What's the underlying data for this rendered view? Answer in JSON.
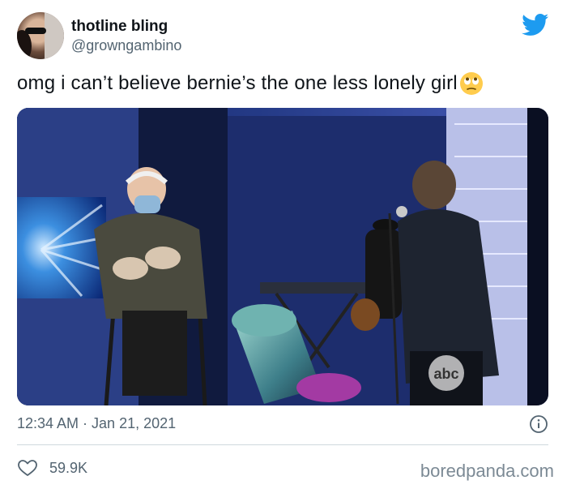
{
  "author": {
    "display_name": "thotline bling",
    "handle": "@growngambino"
  },
  "tweet": {
    "text": "omg i can’t believe bernie’s the one less lonely girl",
    "emoji": "rolling-eyes-emoji",
    "timestamp": "12:34 AM · Jan 21, 2021",
    "likes": "59.9K"
  },
  "icons": {
    "brand": "twitter-bird-icon",
    "info": "info-icon",
    "like": "heart-icon"
  },
  "colors": {
    "twitter_blue": "#1d9bf0",
    "secondary_text": "#536471",
    "primary_text": "#0f1419"
  },
  "watermark": "boredpanda.com",
  "media": {
    "logo_text": "abc"
  }
}
